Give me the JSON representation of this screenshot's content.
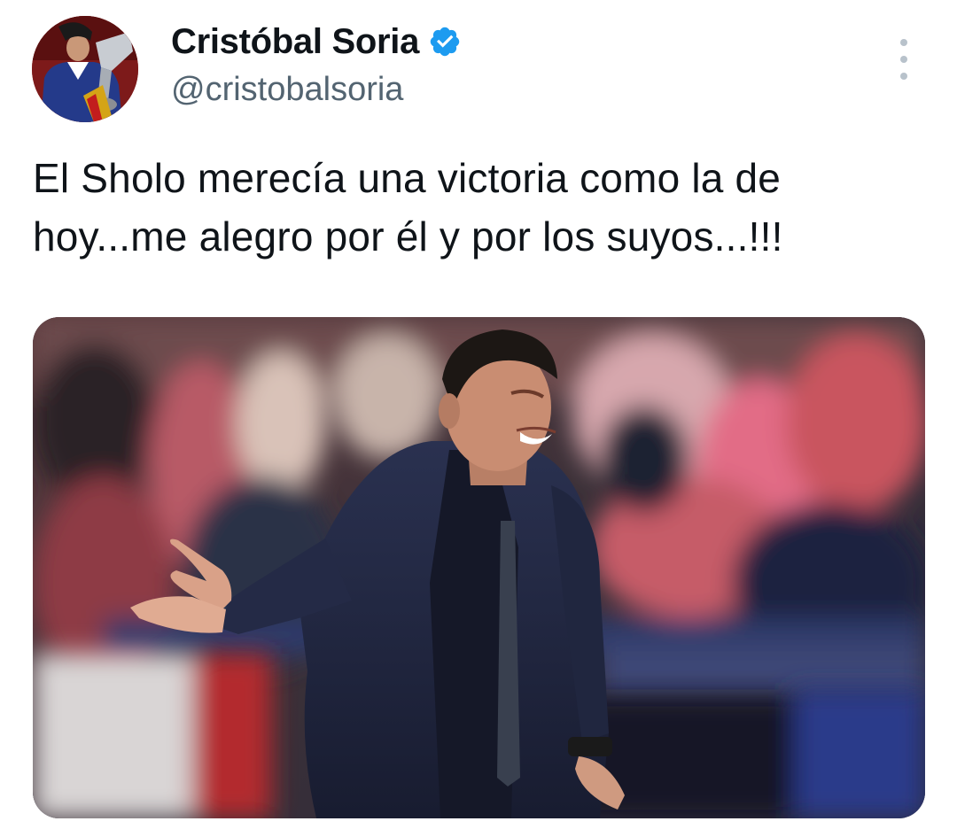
{
  "author": {
    "display_name": "Cristóbal Soria",
    "handle": "@cristobalsoria",
    "verified": true,
    "verified_color": "#1d9bf0"
  },
  "tweet": {
    "text_lines": [
      "El Sholo merecía una victoria como la de",
      "hoy...me alegro por él y por los suyos...!!!"
    ]
  },
  "icons": {
    "more": "more-vertical-icon",
    "verified": "verified-badge-icon"
  }
}
